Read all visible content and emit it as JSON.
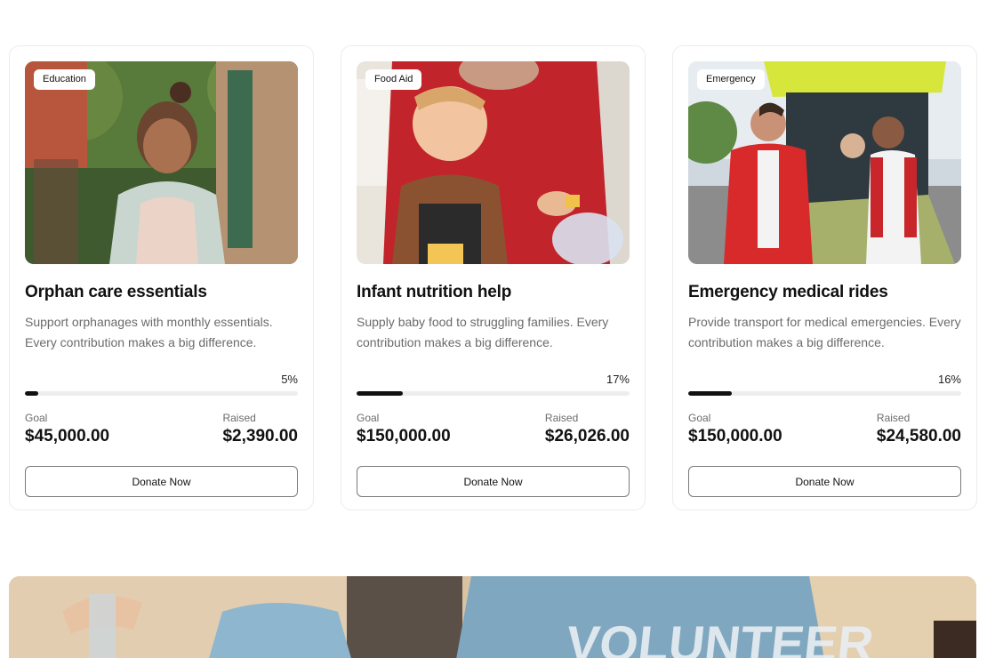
{
  "campaigns": [
    {
      "tag": "Education",
      "title": "Orphan care essentials",
      "description": "Support orphanages with monthly essentials. Every contribution makes a big difference.",
      "progress_percent": 5,
      "progress_label": "5%",
      "goal_label": "Goal",
      "goal_value": "$45,000.00",
      "raised_label": "Raised",
      "raised_value": "$2,390.00",
      "button_label": "Donate Now"
    },
    {
      "tag": "Food Aid",
      "title": "Infant nutrition help",
      "description": "Supply baby food to struggling families. Every contribution makes a big difference.",
      "progress_percent": 17,
      "progress_label": "17%",
      "goal_label": "Goal",
      "goal_value": "$150,000.00",
      "raised_label": "Raised",
      "raised_value": "$26,026.00",
      "button_label": "Donate Now"
    },
    {
      "tag": "Emergency",
      "title": "Emergency medical rides",
      "description": "Provide transport for medical emergencies. Every contribution makes a big difference.",
      "progress_percent": 16,
      "progress_label": "16%",
      "goal_label": "Goal",
      "goal_value": "$150,000.00",
      "raised_label": "Raised",
      "raised_value": "$24,580.00",
      "button_label": "Donate Now"
    }
  ],
  "banner": {
    "shirt_text": "VOLUNTEER"
  },
  "colors": {
    "progress_fill": "#111111",
    "progress_track": "#ededed",
    "text_muted": "#6b6b6b",
    "border": "#ececec"
  }
}
